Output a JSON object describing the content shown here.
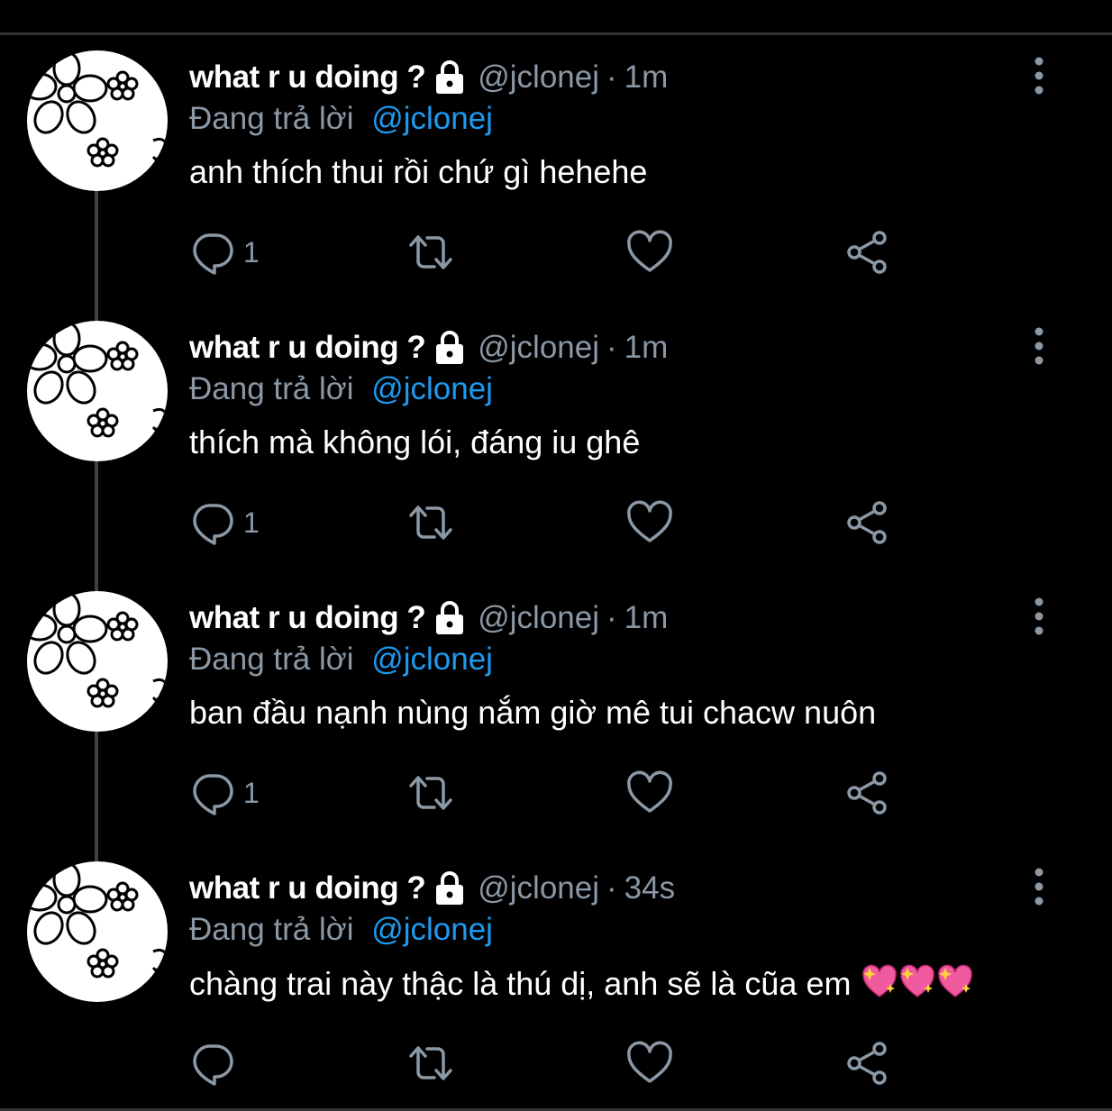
{
  "colors": {
    "background": "#000000",
    "text_primary": "#ffffff",
    "text_secondary": "#8b98a5",
    "link_blue": "#1d9bf0",
    "divider": "#2f3336"
  },
  "tweets": [
    {
      "display_name": "what r u doing ?",
      "handle": "@jclonej",
      "separator": "·",
      "time": "1m",
      "reply_label": "Đang trả lời",
      "reply_handle": "@jclonej",
      "text": "anh thích thui rồi chứ gì hehehe",
      "reply_count": "1",
      "icons": [
        "lock-icon",
        "more-icon",
        "reply-icon",
        "retweet-icon",
        "like-icon",
        "share-icon"
      ]
    },
    {
      "display_name": "what r u doing ?",
      "handle": "@jclonej",
      "separator": "·",
      "time": "1m",
      "reply_label": "Đang trả lời",
      "reply_handle": "@jclonej",
      "text": "thích mà không lói, đáng iu ghê",
      "reply_count": "1"
    },
    {
      "display_name": "what r u doing ?",
      "handle": "@jclonej",
      "separator": "·",
      "time": "1m",
      "reply_label": "Đang trả lời",
      "reply_handle": "@jclonej",
      "text": "ban đầu nạnh nùng nắm giờ mê tui chacw nuôn",
      "reply_count": "1"
    },
    {
      "display_name": "what r u doing ?",
      "handle": "@jclonej",
      "separator": "·",
      "time": "34s",
      "reply_label": "Đang trả lời",
      "reply_handle": "@jclonej",
      "text": "chàng trai này thậc là thú dị, anh sẽ là cũa em",
      "emojis": [
        "sparkling-heart-emoji",
        "sparkling-heart-emoji",
        "sparkling-heart-emoji"
      ],
      "reply_count": ""
    }
  ]
}
